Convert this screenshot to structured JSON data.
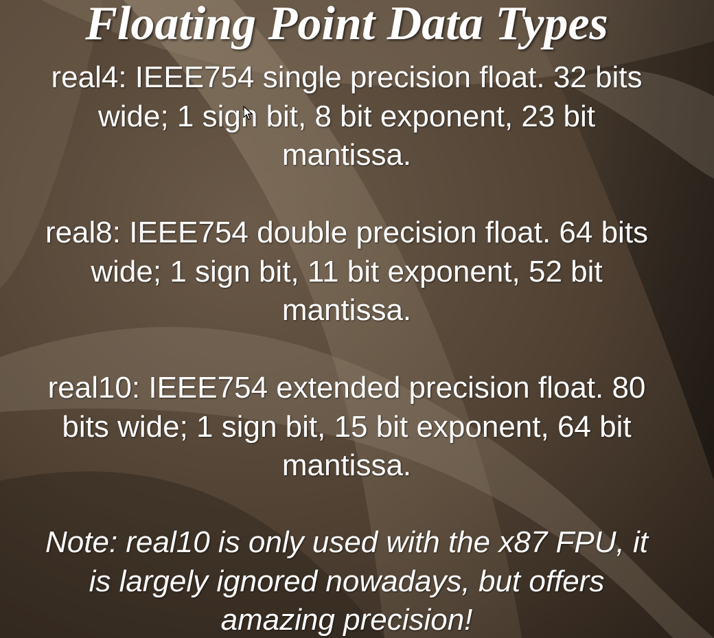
{
  "slide": {
    "title": "Floating Point Data Types",
    "paragraphs": [
      {
        "lines": [
          "real4: IEEE754 single precision float. 32 bits",
          "wide;  1 sign bit, 8 bit exponent, 23 bit",
          "mantissa."
        ]
      },
      {
        "lines": [
          "real8: IEEE754 double precision float. 64 bits",
          "wide; 1 sign bit, 11 bit exponent, 52 bit",
          "mantissa."
        ]
      },
      {
        "lines": [
          "real10: IEEE754 extended precision float. 80",
          "bits wide; 1 sign bit, 15 bit exponent, 64 bit",
          "mantissa."
        ]
      },
      {
        "lines": [
          "Note: real10 is only used with the x87 FPU, it",
          "is largely ignored nowadays, but offers",
          "amazing precision!"
        ]
      }
    ]
  },
  "cursor": {
    "icon": "arrow-cursor-icon"
  },
  "colors": {
    "text": "#ffffff",
    "background_dark": "#2a2119",
    "background_light": "#8a7a68"
  }
}
